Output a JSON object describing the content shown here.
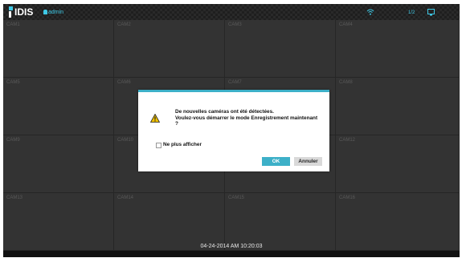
{
  "topbar": {
    "logo_text": "IDIS",
    "user": "admin",
    "page_count": "1/2",
    "icons": [
      "network-icon",
      "monitor-icon"
    ]
  },
  "cameras": [
    "CAM1",
    "CAM2",
    "CAM3",
    "CAM4",
    "CAM5",
    "CAM6",
    "CAM7",
    "CAM8",
    "CAM9",
    "CAM10",
    "CAM11",
    "CAM12",
    "CAM13",
    "CAM14",
    "CAM15",
    "CAM16"
  ],
  "status": {
    "datetime": "04-24-2014  AM 10:20:03"
  },
  "dialog": {
    "line1": "De nouvelles caméras ont été détectées.",
    "line2": "Voulez-vous démarrer le mode Enregistrement maintenant",
    "line3": "?",
    "checkbox_label": "Ne plus afficher",
    "checkbox_checked": false,
    "ok_label": "OK",
    "cancel_label": "Annuler"
  },
  "colors": {
    "accent": "#3db0c8",
    "background": "#2a2a2a"
  }
}
